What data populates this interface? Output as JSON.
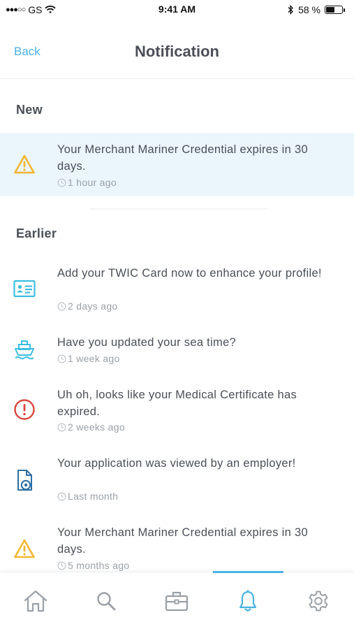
{
  "status_bar": {
    "carrier": "GS",
    "time": "9:41 AM",
    "battery_text": "58 %",
    "battery_level": 0.58
  },
  "nav": {
    "back_label": "Back",
    "title": "Notification"
  },
  "sections": {
    "new_title": "New",
    "earlier_title": "Earlier"
  },
  "new_items": [
    {
      "icon": "warning-icon",
      "text": "Your Merchant Mariner Credential expires in 30 days.",
      "time": "1 hour ago"
    }
  ],
  "earlier_items": [
    {
      "icon": "id-card-icon",
      "text": "Add your TWIC Card now to enhance your profile!",
      "time": "2 days ago"
    },
    {
      "icon": "ship-icon",
      "text": "Have you updated your sea time?",
      "time": "1 week ago"
    },
    {
      "icon": "alert-circle-icon",
      "text": "Uh oh, looks like your Medical Certificate has expired.",
      "time": "2 weeks ago"
    },
    {
      "icon": "document-view-icon",
      "text": "Your application was viewed by an employer!",
      "time": "Last month"
    },
    {
      "icon": "warning-icon",
      "text": "Your Merchant Mariner Credential expires in 30 days.",
      "time": "5 months ago"
    }
  ],
  "tabs": [
    {
      "icon": "home-icon"
    },
    {
      "icon": "search-icon"
    },
    {
      "icon": "briefcase-icon"
    },
    {
      "icon": "bell-icon",
      "active": true
    },
    {
      "icon": "gear-icon"
    }
  ],
  "colors": {
    "accent": "#4ab3e2",
    "warning": "#f2b632",
    "error": "#d9463b",
    "highlight_bg": "#ebf5fc",
    "doc_icon": "#2c6fa3"
  }
}
